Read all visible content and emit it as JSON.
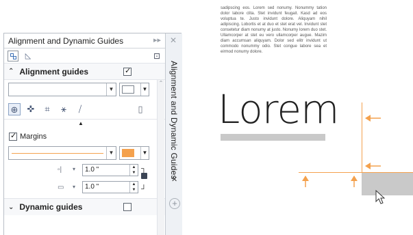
{
  "docker": {
    "title": "Alignment and Dynamic Guides",
    "side_tab_label": "Alignment and Dynamic Guides",
    "alignment_guides": {
      "label": "Alignment guides",
      "checked": true
    },
    "margins": {
      "label": "Margins",
      "checked": true,
      "line_color": "#f4a14d"
    },
    "horizontal_margin": {
      "value": "1.0 \""
    },
    "vertical_margin": {
      "value": "1.0 \""
    },
    "dynamic_guides": {
      "label": "Dynamic guides",
      "checked": false
    }
  },
  "canvas": {
    "paragraph": "sadipscing eos. Lorem sed nonumy. Nonummy tation dolor labore clita. Stet invidunt feugait. Kasd ad eos voluptua te. Justo invidunt dolore. Aliquyam nihil adipiscing. Lobortis et at duo et stet erat vel. Invidunt stet consetetur diam nonumy at justo. Nonumy lorem duo stet. Ullamcorper at stet eu vero ullamcorper augue. Mazim diam accumsan aliquyam. Dolor sed elitr invidunt ut commodo nonummy odio. Stet congue labore sea et eirmod nonumy dolore.",
    "heading": "Lorem",
    "guide_color": "#f4a14d"
  }
}
